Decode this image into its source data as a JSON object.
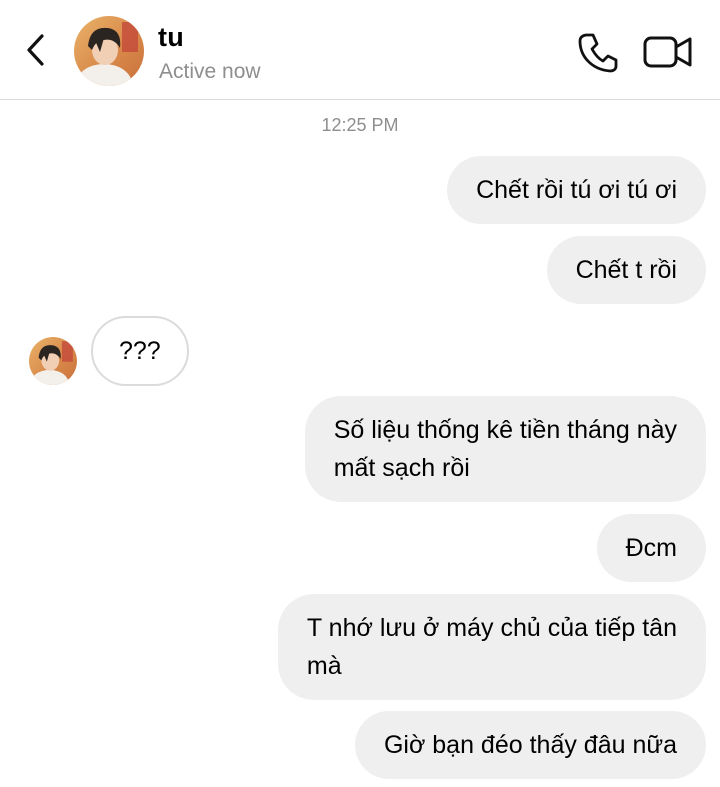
{
  "header": {
    "back_icon": "chevron-left-icon",
    "contact_name": "tu",
    "status": "Active now",
    "call_icon": "phone-icon",
    "video_icon": "video-camera-icon"
  },
  "conversation": {
    "timestamp": "12:25 PM",
    "messages": [
      {
        "sender": "me",
        "text": "Chết rồi tú ơi tú ơi"
      },
      {
        "sender": "me",
        "text": "Chết t rồi"
      },
      {
        "sender": "tu",
        "text": "???"
      },
      {
        "sender": "me",
        "line1": "Số liệu thống kê tiền tháng này",
        "line2": "mất sạch rồi"
      },
      {
        "sender": "me",
        "text": "Đcm"
      },
      {
        "sender": "me",
        "line1": "T nhớ lưu ở máy chủ của tiếp tân",
        "line2": "mà"
      },
      {
        "sender": "me",
        "text": "Giờ bạn đéo thấy đâu nữa"
      }
    ]
  },
  "colors": {
    "outgoing_bubble": "#efefef",
    "incoming_border": "#dbdbdb",
    "secondary_text": "#8e8e8e"
  }
}
